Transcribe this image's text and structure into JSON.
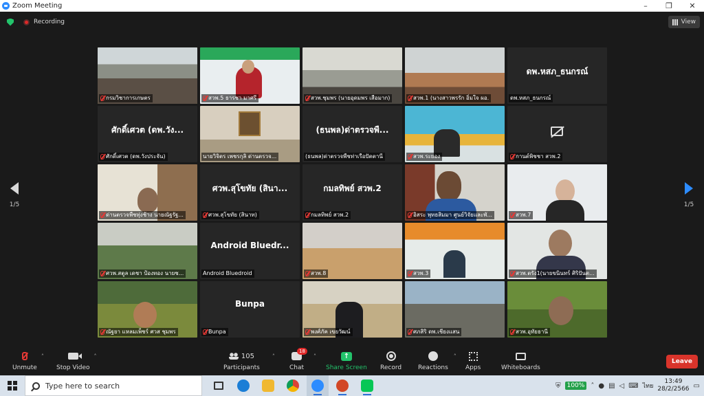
{
  "window": {
    "title": "Zoom Meeting",
    "controls": [
      "–",
      "❐",
      "✕"
    ]
  },
  "topbar": {
    "recording_label": "Recording",
    "view_label": "View"
  },
  "pagination": {
    "left_page": "1/5",
    "right_page": "1/5"
  },
  "tiles": [
    {
      "label": "กรมวิชาการเกษตร",
      "big": "",
      "muted": true,
      "active": true,
      "video": "v1"
    },
    {
      "label": "สวพ.5 ธารชา มาศรี",
      "big": "",
      "muted": true,
      "active": false,
      "video": "v2"
    },
    {
      "label": "สวพ.ชุมพร (นายอุดมพร เสือมาก)",
      "big": "",
      "muted": true,
      "active": false,
      "video": "v3"
    },
    {
      "label": "สวพ.1 (นางสาวพรรัก อิ่มใจ ผอ.",
      "big": "",
      "muted": true,
      "active": false,
      "video": "v4"
    },
    {
      "label": "ดพ.หสภ_ธนกรณ์",
      "big": "ดพ.หสภ_ธนกรณ์",
      "muted": false,
      "active": false,
      "video": ""
    },
    {
      "label": "ศักดิ์เศวต (ดพ.วังประจัน)",
      "big": "ศักดิ์เศวต (ดพ.วัง...",
      "muted": true,
      "active": false,
      "video": ""
    },
    {
      "label": "นายวิจิตร เพชรกุลิ ด่านตรวจ...",
      "big": "",
      "muted": false,
      "active": false,
      "video": "v5"
    },
    {
      "label": "(ธนพล)ด่าตรวจพืชท่าเรือปัตตานี",
      "big": "(ธนพล)ด่าตรวจพื...",
      "muted": false,
      "active": false,
      "video": ""
    },
    {
      "label": "สวพ.ระยอง",
      "big": "",
      "muted": true,
      "active": false,
      "video": "v6"
    },
    {
      "label": "กานต์พิชชา สวพ.2",
      "big": "",
      "muted": true,
      "active": false,
      "video": "camoff"
    },
    {
      "label": "ด่านตรวจพืชทุ่งช้าง นายณัฐรัฐ...",
      "big": "",
      "muted": true,
      "active": false,
      "video": "v7"
    },
    {
      "label": "ศวพ.สุโขทัย (สินาท)",
      "big": "ศวพ.สุโขทัย (สินา...",
      "muted": true,
      "active": false,
      "video": ""
    },
    {
      "label": "กมลทิพย์ สวพ.2",
      "big": "กมลทิพย์ สวพ.2",
      "muted": true,
      "active": false,
      "video": ""
    },
    {
      "label": "อิสระ พุทธสิมมา ศูนย์วิจัยและพั...",
      "big": "",
      "muted": true,
      "active": false,
      "video": "v8"
    },
    {
      "label": "สวพ.7",
      "big": "",
      "muted": true,
      "active": false,
      "video": "v9"
    },
    {
      "label": "ศวพ.สตูล เดชา ป้องทอง นายช...",
      "big": "",
      "muted": true,
      "active": false,
      "video": "v10"
    },
    {
      "label": "Android Bluedroid",
      "big": "Android Bluedr...",
      "muted": false,
      "active": false,
      "video": ""
    },
    {
      "label": "สวพ.8",
      "big": "",
      "muted": true,
      "active": false,
      "video": "v11"
    },
    {
      "label": "สวพ.3",
      "big": "",
      "muted": true,
      "active": false,
      "video": "v12"
    },
    {
      "label": "สวพ.ตรัง1(นายขนินทร์ ศิริปันต...",
      "big": "",
      "muted": true,
      "active": false,
      "video": "v13"
    },
    {
      "label": "ณัฐยา แหลมเพ็ชร์ ศวส ชุมพร",
      "big": "",
      "muted": true,
      "active": false,
      "video": "v14"
    },
    {
      "label": "Bunpa",
      "big": "Bunpa",
      "muted": true,
      "active": false,
      "video": ""
    },
    {
      "label": "พงศ์ภัค เขยวัฒน์",
      "big": "",
      "muted": true,
      "active": false,
      "video": "v15"
    },
    {
      "label": "ศภสิริ ดพ.เชียงแสน",
      "big": "",
      "muted": true,
      "active": false,
      "video": "v16"
    },
    {
      "label": "สวพ.อุทัยธานี",
      "big": "",
      "muted": true,
      "active": false,
      "video": "v17"
    }
  ],
  "toolbar": {
    "unmute": "Unmute",
    "stop_video": "Stop Video",
    "participants": "Participants",
    "participants_count": "105",
    "chat": "Chat",
    "chat_badge": "18",
    "share_screen": "Share Screen",
    "record": "Record",
    "reactions": "Reactions",
    "apps": "Apps",
    "whiteboards": "Whiteboards",
    "leave": "Leave"
  },
  "taskbar": {
    "search_placeholder": "Type here to search",
    "battery": "100%",
    "language": "ไทย",
    "time": "13:49",
    "date": "28/2/2566"
  },
  "colors": {
    "accent": "#2d8cff",
    "share_green": "#23c36b",
    "leave_red": "#d9342b",
    "active_speaker": "#c7e24a"
  }
}
